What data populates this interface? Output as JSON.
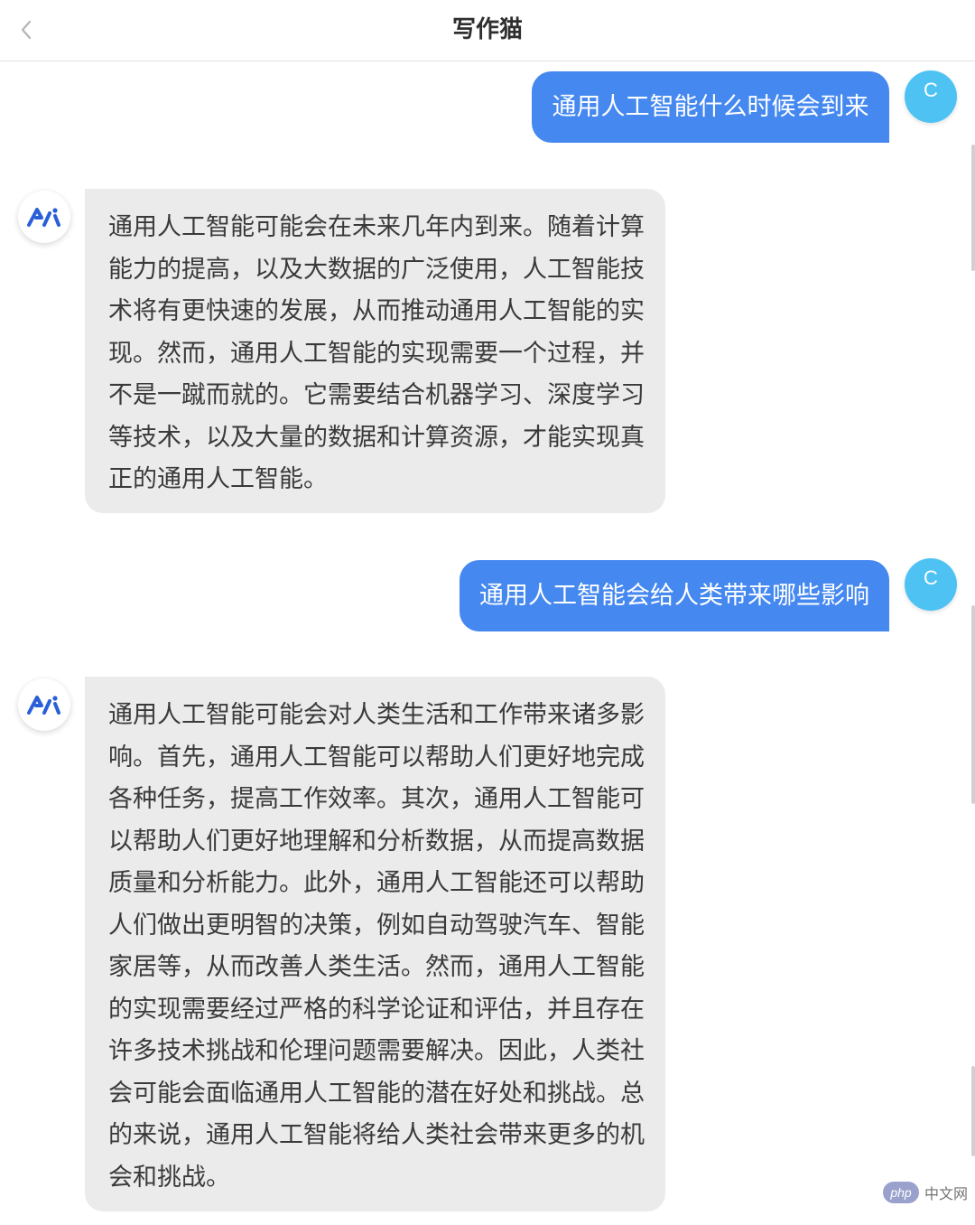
{
  "header": {
    "title": "写作猫",
    "back_icon": "chevron-left-icon"
  },
  "colors": {
    "user_bubble": "#4588f0",
    "user_avatar": "#4ec3f3",
    "ai_bubble": "#ebebeb",
    "ai_logo": "#2a5fd8"
  },
  "messages": [
    {
      "role": "user",
      "avatar_letter": "C",
      "text": "通用人工智能什么时候会到来"
    },
    {
      "role": "assistant",
      "avatar_icon": "ai-logo-icon",
      "lines": [
        "通用人工智能可能会在未来几年内到来。随着计算",
        "能力的提高，以及大数据的广泛使用，人工智能技",
        "术将有更快速的发展，从而推动通用人工智能的实",
        "现。然而，通用人工智能的实现需要一个过程，并",
        "不是一蹴而就的。它需要结合机器学习、深度学习",
        "等技术，以及大量的数据和计算资源，才能实现真",
        "正的通用人工智能。"
      ]
    },
    {
      "role": "user",
      "avatar_letter": "C",
      "text": "通用人工智能会给人类带来哪些影响"
    },
    {
      "role": "assistant",
      "avatar_icon": "ai-logo-icon",
      "lines": [
        "通用人工智能可能会对人类生活和工作带来诸多影",
        "响。首先，通用人工智能可以帮助人们更好地完成",
        "各种任务，提高工作效率。其次，通用人工智能可",
        "以帮助人们更好地理解和分析数据，从而提高数据",
        "质量和分析能力。此外，通用人工智能还可以帮助",
        "人们做出更明智的决策，例如自动驾驶汽车、智能",
        "家居等，从而改善人类生活。然而，通用人工智能",
        "的实现需要经过严格的科学论证和评估，并且存在",
        "许多技术挑战和伦理问题需要解决。因此，人类社",
        "会可能会面临通用人工智能的潜在好处和挑战。总",
        "的来说，通用人工智能将给人类社会带来更多的机",
        "会和挑战。"
      ]
    }
  ],
  "watermark": {
    "badge": "php",
    "text": "中文网"
  }
}
